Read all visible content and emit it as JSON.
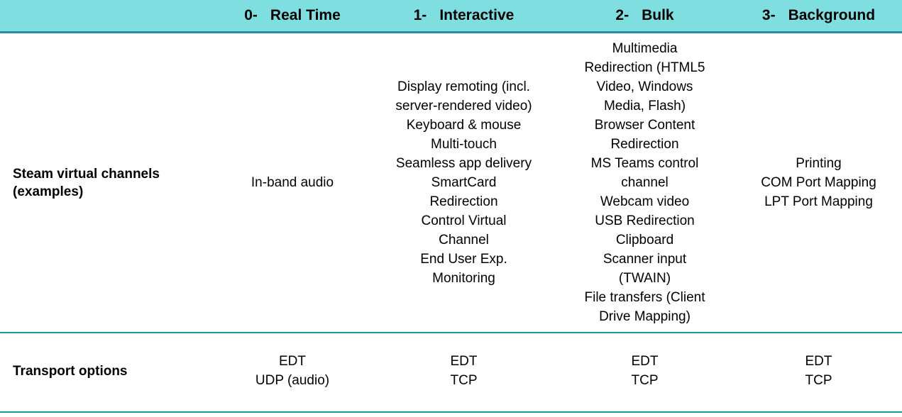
{
  "table": {
    "header": {
      "row_label_header": "",
      "columns": [
        {
          "number": "0-",
          "label": "Real Time"
        },
        {
          "number": "1-",
          "label": "Interactive"
        },
        {
          "number": "2-",
          "label": "Bulk"
        },
        {
          "number": "3-",
          "label": "Background"
        }
      ]
    },
    "rows": [
      {
        "label": "Steam virtual channels (examples)",
        "label_lines": [
          "Steam virtual channels",
          "(examples)"
        ],
        "cells": [
          {
            "column": "Real Time",
            "lines": [
              "In-band audio"
            ]
          },
          {
            "column": "Interactive",
            "lines": [
              "Display remoting (incl.",
              "server-rendered video)",
              "Keyboard & mouse",
              "Multi-touch",
              "Seamless app delivery",
              "SmartCard",
              "Redirection",
              "Control Virtual",
              "Channel",
              "End User Exp.",
              "Monitoring"
            ]
          },
          {
            "column": "Bulk",
            "lines": [
              "Multimedia",
              "Redirection (HTML5",
              "Video, Windows",
              "Media, Flash)",
              "Browser Content",
              "Redirection",
              "MS Teams control",
              "channel",
              "Webcam video",
              "USB Redirection",
              "Clipboard",
              "Scanner input",
              "(TWAIN)",
              "File transfers (Client",
              "Drive Mapping)"
            ]
          },
          {
            "column": "Background",
            "lines": [
              "Printing",
              "COM Port Mapping",
              "LPT Port Mapping"
            ]
          }
        ]
      },
      {
        "label": "Transport options",
        "label_lines": [
          "Transport options"
        ],
        "cells": [
          {
            "column": "Real Time",
            "lines": [
              "EDT",
              "UDP (audio)"
            ]
          },
          {
            "column": "Interactive",
            "lines": [
              "EDT",
              "TCP"
            ]
          },
          {
            "column": "Bulk",
            "lines": [
              "EDT",
              "TCP"
            ]
          },
          {
            "column": "Background",
            "lines": [
              "EDT",
              "TCP"
            ]
          }
        ]
      }
    ]
  },
  "colors": {
    "header_band": "#7FDEE0",
    "rule": "#1F8FA4",
    "text": "#000000",
    "background": "#FFFFFF"
  }
}
